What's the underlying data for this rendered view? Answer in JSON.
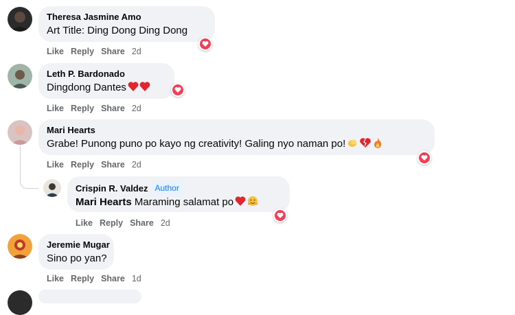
{
  "comments": [
    {
      "author": "Theresa Jasmine Amo",
      "text": "Art Title: Ding Dong Ding Dong",
      "actions": {
        "like": "Like",
        "reply": "Reply",
        "share": "Share",
        "time": "2d"
      }
    },
    {
      "author": "Leth P. Bardonado",
      "text": "Dingdong Dantes",
      "actions": {
        "like": "Like",
        "reply": "Reply",
        "share": "Share",
        "time": "2d"
      }
    },
    {
      "author": "Mari Hearts",
      "text": "Grabe! Punong puno po kayo ng creativity! Galing nyo naman po!",
      "actions": {
        "like": "Like",
        "reply": "Reply",
        "share": "Share",
        "time": "2d"
      }
    },
    {
      "author": "Crispin R. Valdez",
      "badge": "Author",
      "mention": "Mari Hearts",
      "text": "Maraming salamat po",
      "actions": {
        "like": "Like",
        "reply": "Reply",
        "share": "Share",
        "time": "2d"
      }
    },
    {
      "author": "Jeremie Mugar",
      "text": "Sino po yan?",
      "actions": {
        "like": "Like",
        "reply": "Reply",
        "share": "Share",
        "time": "1d"
      }
    }
  ],
  "colors": {
    "bubble": "#f0f2f5",
    "heart_reaction": "#f33e58",
    "author_badge": "#1877f2",
    "action_text": "#65676b"
  }
}
